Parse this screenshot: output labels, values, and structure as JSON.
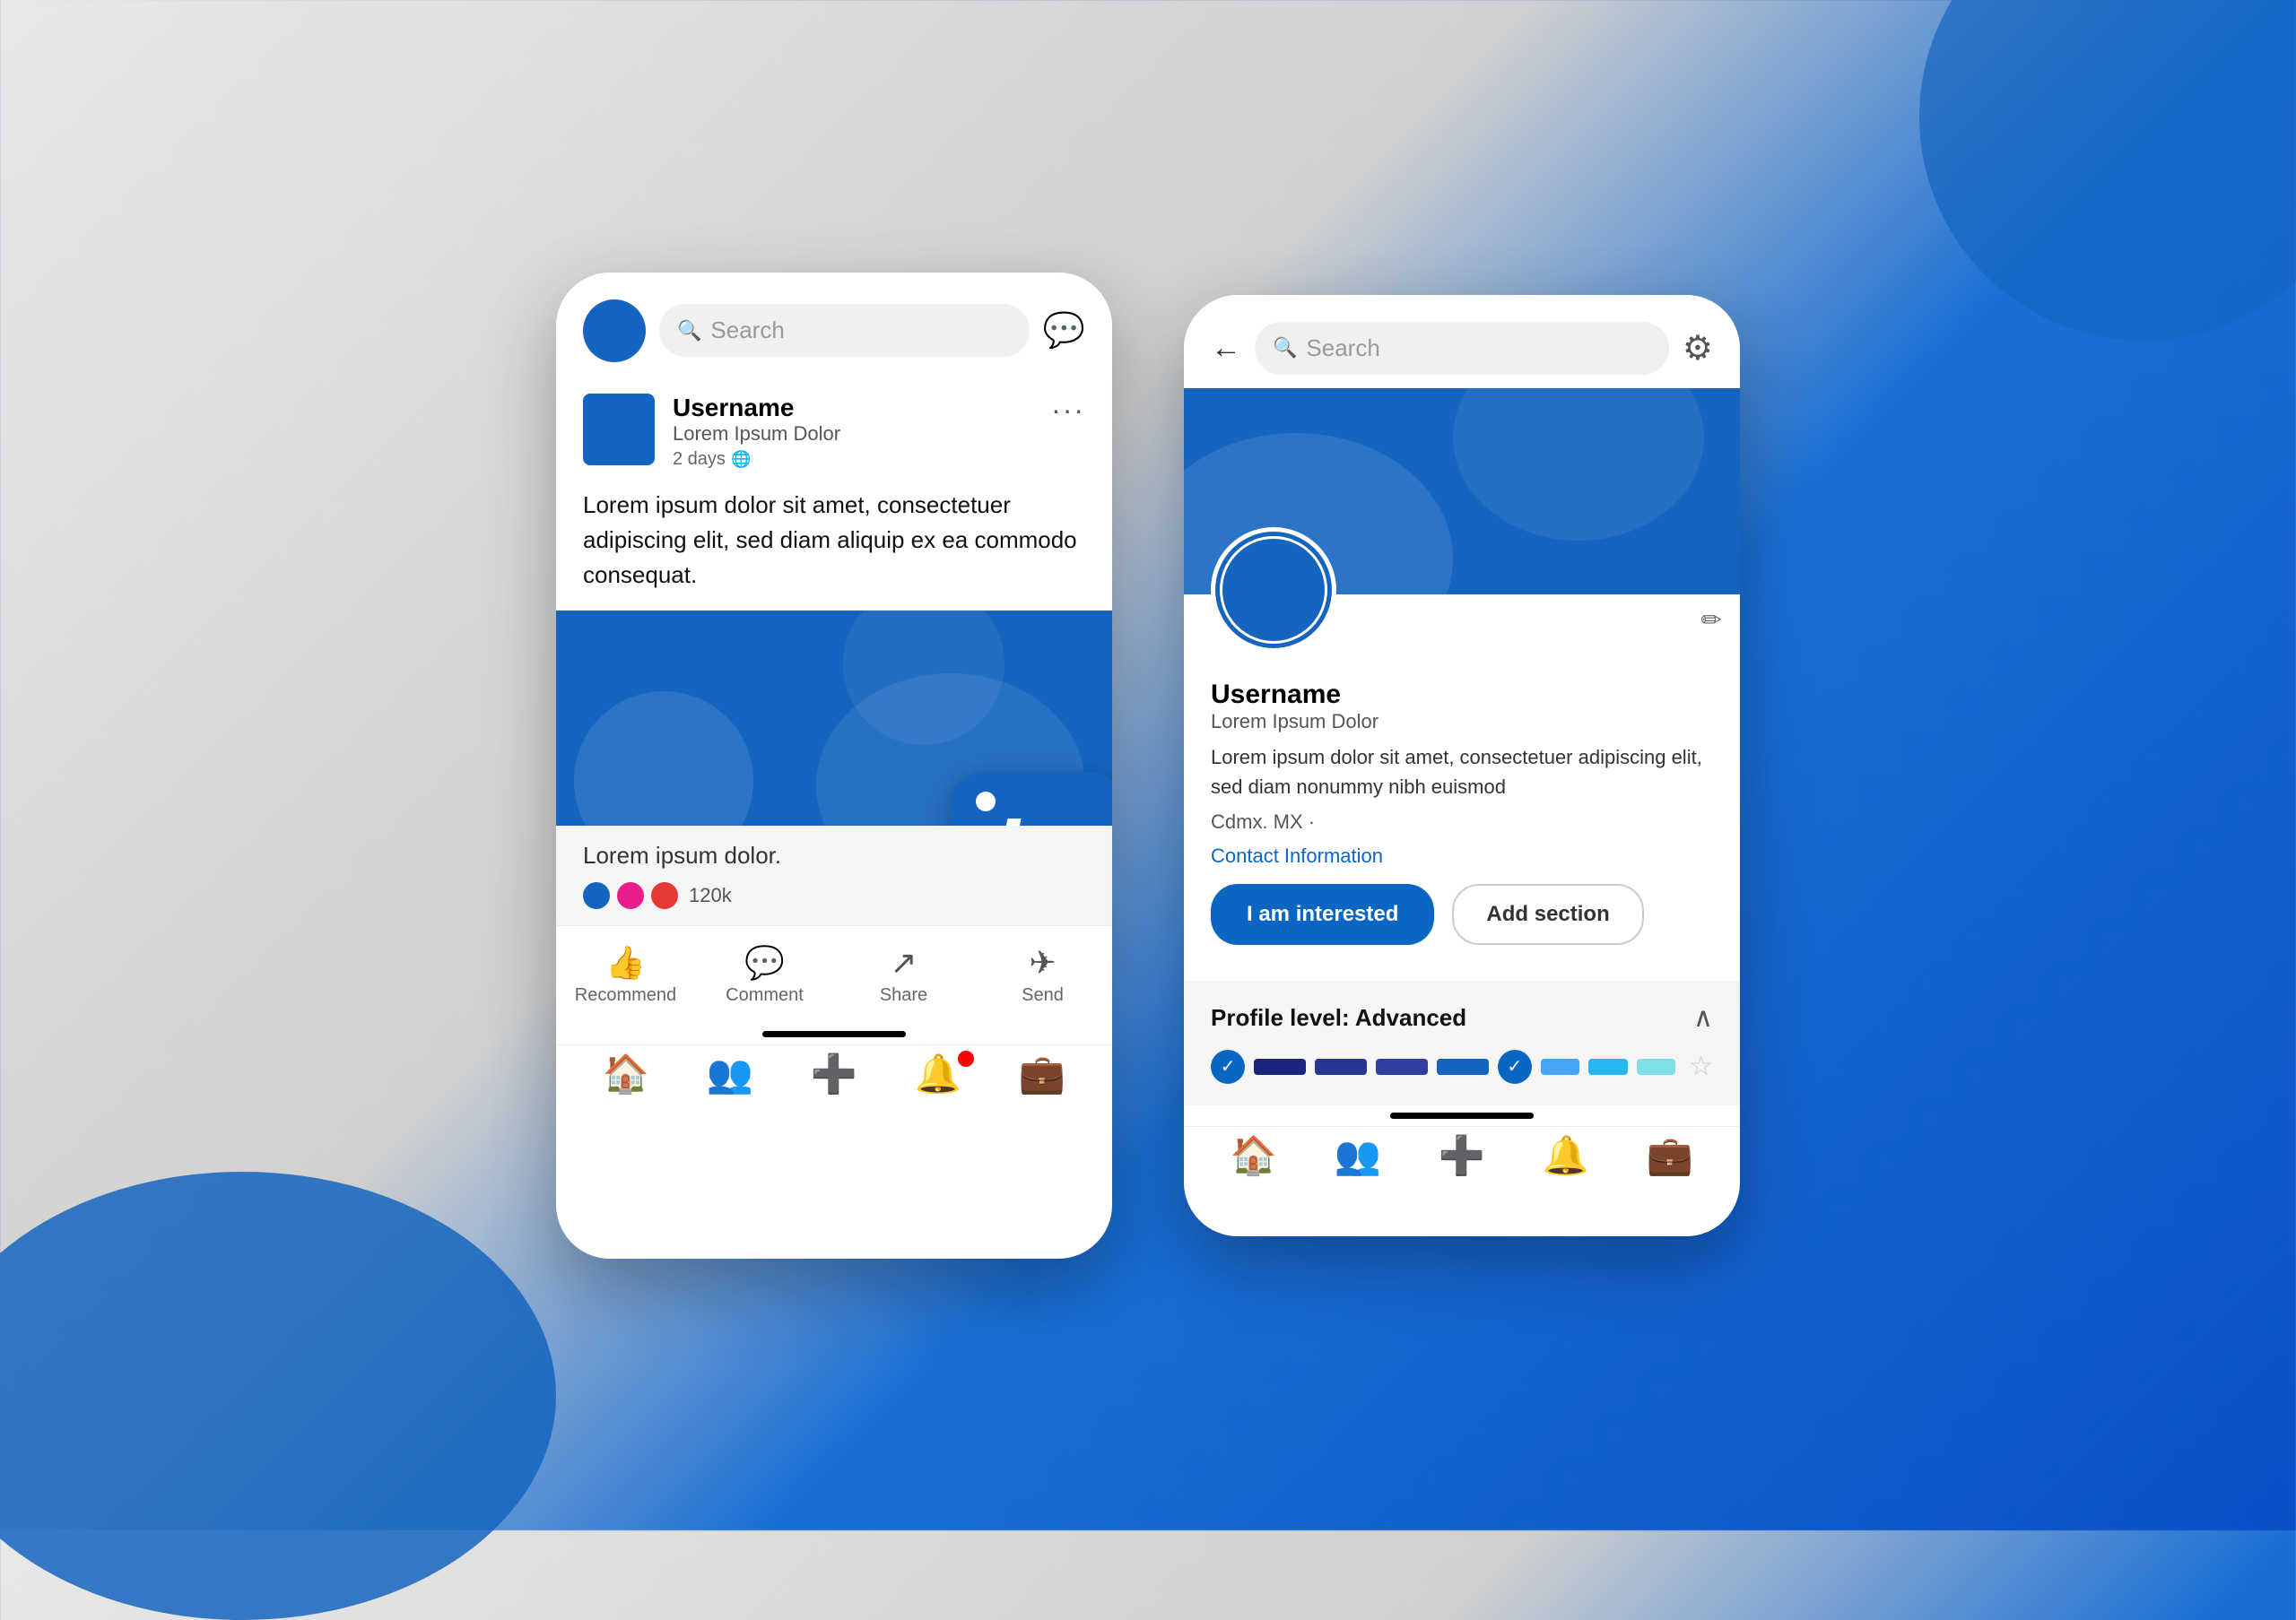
{
  "background": {
    "colors": {
      "left": "#e8e8e8",
      "right": "#0a4fc7",
      "blob": "#1565c0"
    }
  },
  "phone1": {
    "header": {
      "search_placeholder": "Search",
      "avatar_color": "#1565c0"
    },
    "post": {
      "username": "Username",
      "subtitle": "Lorem Ipsum Dolor",
      "time": "2 days",
      "text": "Lorem ipsum dolor sit amet, consectetuer adipiscing elit, sed diam aliquip ex ea commodo consequat.",
      "caption": "Lorem ipsum dolor.",
      "reaction_count": "120k"
    },
    "actions": {
      "recommend": "Recommend",
      "comment": "Comment",
      "share": "Share",
      "send": "Send"
    },
    "nav": {
      "home": "🏠",
      "people": "👥",
      "add": "➕",
      "notifications": "🔔",
      "briefcase": "💼"
    }
  },
  "phone2": {
    "header": {
      "search_placeholder": "Search"
    },
    "profile": {
      "username": "Username",
      "subtitle": "Lorem Ipsum Dolor",
      "bio": "Lorem ipsum dolor sit amet, consectetuer adipiscing elit, sed diam nonummy nibh euismod",
      "location": "Cdmx. MX ·",
      "contact_link": "Contact Information"
    },
    "buttons": {
      "interested": "I am interested",
      "add_section": "Add section"
    },
    "level": {
      "title": "Profile level: Advanced"
    },
    "nav": {
      "home": "🏠",
      "people": "👥",
      "add": "➕",
      "notifications": "🔔",
      "briefcase": "💼"
    }
  },
  "linkedin_badge": {
    "letter": "in"
  }
}
